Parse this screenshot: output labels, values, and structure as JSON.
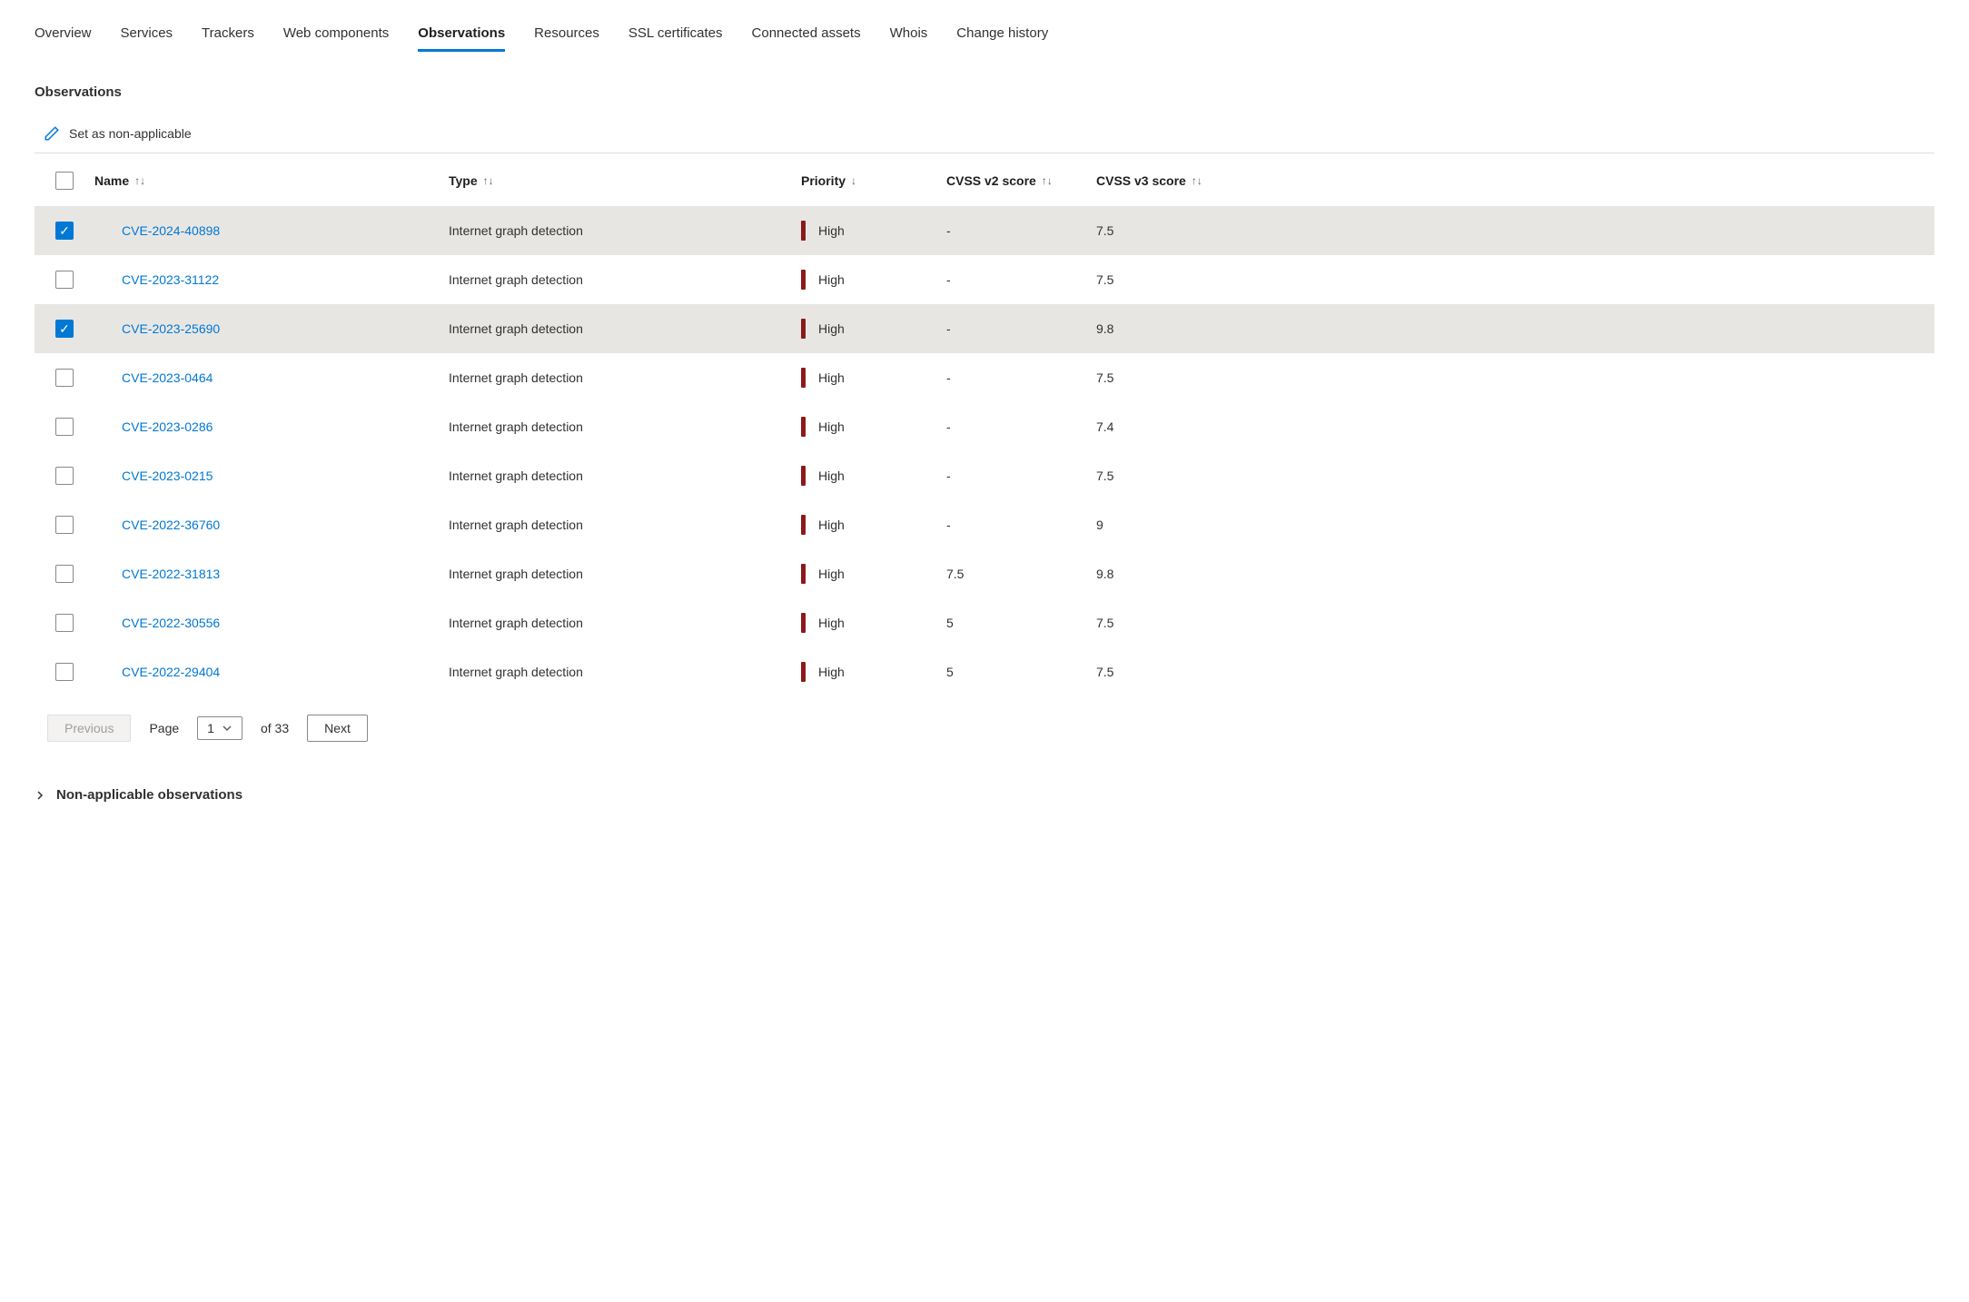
{
  "tabs": [
    {
      "label": "Overview",
      "active": false
    },
    {
      "label": "Services",
      "active": false
    },
    {
      "label": "Trackers",
      "active": false
    },
    {
      "label": "Web components",
      "active": false
    },
    {
      "label": "Observations",
      "active": true
    },
    {
      "label": "Resources",
      "active": false
    },
    {
      "label": "SSL certificates",
      "active": false
    },
    {
      "label": "Connected assets",
      "active": false
    },
    {
      "label": "Whois",
      "active": false
    },
    {
      "label": "Change history",
      "active": false
    }
  ],
  "section_title": "Observations",
  "action_set_non_applicable": "Set as non-applicable",
  "columns": {
    "name": "Name",
    "type": "Type",
    "priority": "Priority",
    "cvss2": "CVSS v2 score",
    "cvss3": "CVSS v3 score"
  },
  "sort_glyphs": {
    "updown": "↑↓",
    "down": "↓"
  },
  "rows": [
    {
      "selected": true,
      "name": "CVE-2024-40898",
      "type": "Internet graph detection",
      "priority": "High",
      "cvss2": "-",
      "cvss3": "7.5"
    },
    {
      "selected": false,
      "name": "CVE-2023-31122",
      "type": "Internet graph detection",
      "priority": "High",
      "cvss2": "-",
      "cvss3": "7.5"
    },
    {
      "selected": true,
      "name": "CVE-2023-25690",
      "type": "Internet graph detection",
      "priority": "High",
      "cvss2": "-",
      "cvss3": "9.8"
    },
    {
      "selected": false,
      "name": "CVE-2023-0464",
      "type": "Internet graph detection",
      "priority": "High",
      "cvss2": "-",
      "cvss3": "7.5"
    },
    {
      "selected": false,
      "name": "CVE-2023-0286",
      "type": "Internet graph detection",
      "priority": "High",
      "cvss2": "-",
      "cvss3": "7.4"
    },
    {
      "selected": false,
      "name": "CVE-2023-0215",
      "type": "Internet graph detection",
      "priority": "High",
      "cvss2": "-",
      "cvss3": "7.5"
    },
    {
      "selected": false,
      "name": "CVE-2022-36760",
      "type": "Internet graph detection",
      "priority": "High",
      "cvss2": "-",
      "cvss3": "9"
    },
    {
      "selected": false,
      "name": "CVE-2022-31813",
      "type": "Internet graph detection",
      "priority": "High",
      "cvss2": "7.5",
      "cvss3": "9.8"
    },
    {
      "selected": false,
      "name": "CVE-2022-30556",
      "type": "Internet graph detection",
      "priority": "High",
      "cvss2": "5",
      "cvss3": "7.5"
    },
    {
      "selected": false,
      "name": "CVE-2022-29404",
      "type": "Internet graph detection",
      "priority": "High",
      "cvss2": "5",
      "cvss3": "7.5"
    }
  ],
  "pagination": {
    "previous": "Previous",
    "page_label": "Page",
    "current_page": "1",
    "of_label": "of 33",
    "next": "Next"
  },
  "collapsible_label": "Non-applicable observations"
}
